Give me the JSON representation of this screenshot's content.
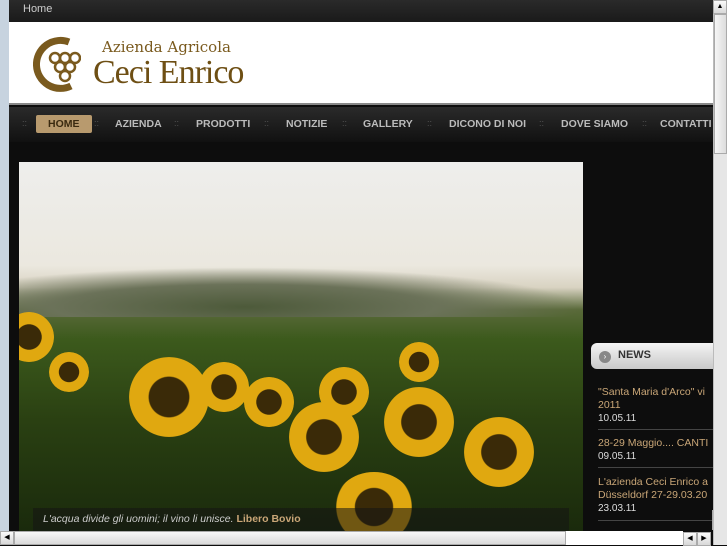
{
  "topbar": {
    "home": "Home"
  },
  "logo": {
    "subtitle": "Azienda Agricola",
    "title": "Ceci Enrico"
  },
  "nav": [
    "HOME",
    "AZIENDA",
    "PRODOTTI",
    "NOTIZIE",
    "GALLERY",
    "DICONO DI NOI",
    "DOVE SIAMO",
    "CONTATTI"
  ],
  "slideshow": {
    "quote": "L'acqua divide gli uomini; il vino li unisce.",
    "author": "Libero Bovio"
  },
  "news": {
    "title": "NEWS",
    "items": [
      {
        "title": "\"Santa Maria d'Arco\" vi",
        "title2": "2011",
        "date": "10.05.11"
      },
      {
        "title": "28-29 Maggio.... CANTI",
        "date": "09.05.11"
      },
      {
        "title": "L'azienda Ceci Enrico a",
        "title2": "Düsseldorf 27-29.03.20",
        "date": "23.03.11"
      }
    ]
  }
}
